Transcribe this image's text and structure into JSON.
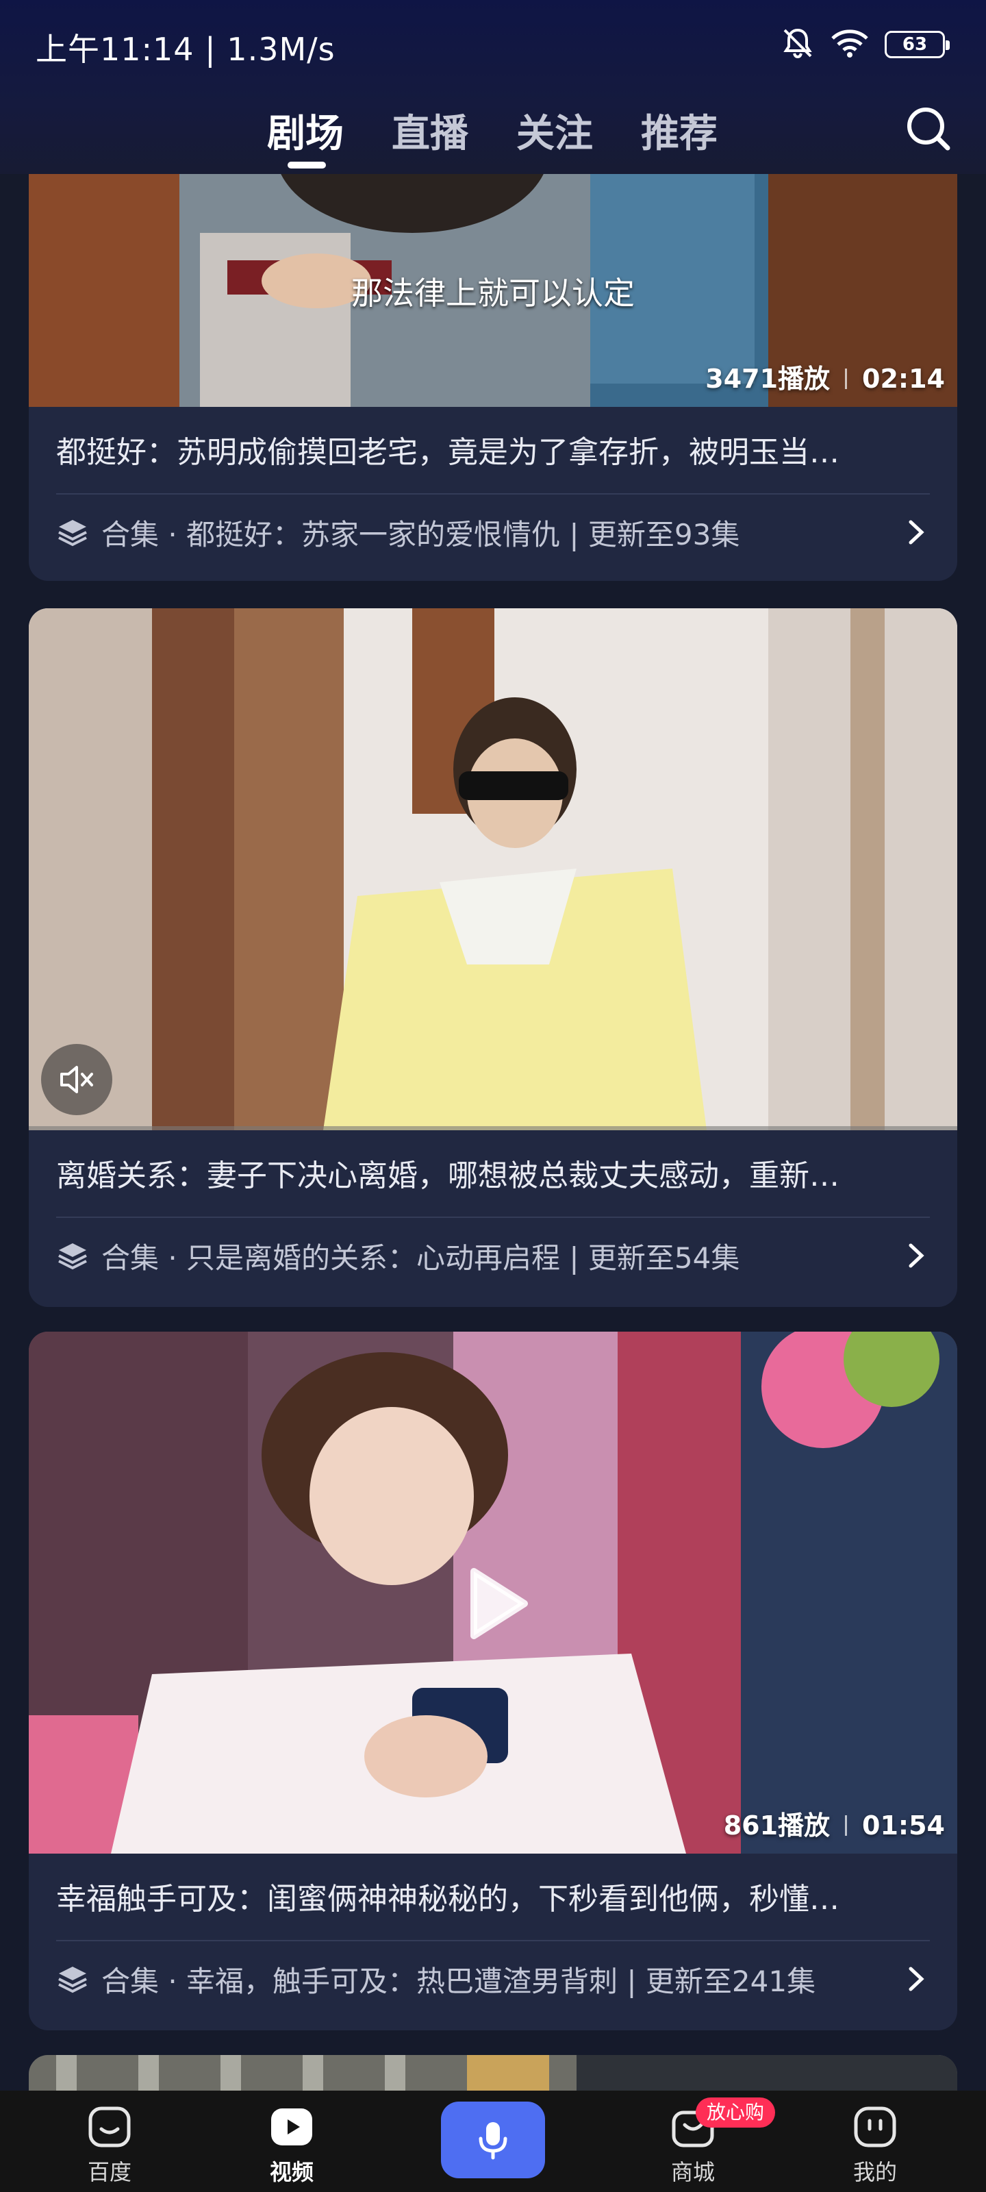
{
  "status_bar": {
    "time": "上午11:14 | 1.3M/s",
    "battery": "63"
  },
  "top_tabs": [
    {
      "label": "剧场",
      "active": true
    },
    {
      "label": "直播",
      "active": false
    },
    {
      "label": "关注",
      "active": false
    },
    {
      "label": "推荐",
      "active": false
    }
  ],
  "feed": [
    {
      "subtitle": "那法律上就可以认定",
      "views": "3471播放",
      "duration": "02:14",
      "title": "都挺好：苏明成偷摸回老宅，竟是为了拿存折，被明玉当…",
      "series": "合集 · 都挺好：苏家一家的爱恨情仇 | 更新至93集"
    },
    {
      "title": "离婚关系：妻子下决心离婚，哪想被总裁丈夫感动，重新…",
      "series": "合集 · 只是离婚的关系：心动再启程 | 更新至54集"
    },
    {
      "views": "861播放",
      "duration": "01:54",
      "title": "幸福触手可及：闺蜜俩神神秘秘的，下秒看到他俩，秒懂…",
      "series": "合集 · 幸福，触手可及：热巴遭渣男背刺 | 更新至241集"
    }
  ],
  "bottom_nav": {
    "items": [
      {
        "label": "百度"
      },
      {
        "label": "视频"
      },
      {
        "label": "商城"
      },
      {
        "label": "我的"
      }
    ],
    "badge": "放心购"
  },
  "colors": {
    "accent": "#4e6ef2",
    "badge": "#ff2e56",
    "card_bg": "#212841",
    "page_bg": "#151a2b"
  }
}
